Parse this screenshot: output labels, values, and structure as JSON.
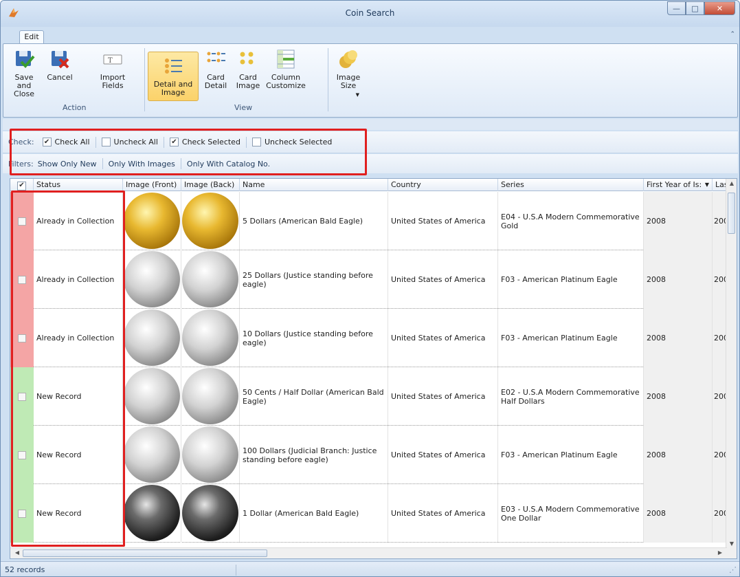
{
  "window": {
    "title": "Coin Search"
  },
  "ribbon": {
    "tab": "Edit",
    "buttons": {
      "save_close": "Save and\nClose",
      "cancel": "Cancel",
      "import_fields": "Import\nFields",
      "detail_image": "Detail and\nImage",
      "card_detail": "Card\nDetail",
      "card_image": "Card\nImage",
      "column_customize": "Column\nCustomize",
      "image_size": "Image\nSize"
    },
    "groups": {
      "action": "Action",
      "view": "View"
    }
  },
  "checkbar": {
    "label": "Check:",
    "check_all": "Check All",
    "uncheck_all": "Uncheck All",
    "check_selected": "Check Selected",
    "uncheck_selected": "Uncheck Selected"
  },
  "filterbar": {
    "label": "Filters:",
    "show_only_new": "Show Only New",
    "only_with_images": "Only With Images",
    "only_with_catalog": "Only With Catalog No."
  },
  "grid": {
    "columns": [
      "Status",
      "Image (Front)",
      "Image (Back)",
      "Name",
      "Country",
      "Series",
      "First Year of Is:",
      "Last"
    ],
    "rows": [
      {
        "status": "Already in Collection",
        "status_color": "#f4a5a5",
        "name": "5 Dollars (American Bald Eagle)",
        "country": "United States of America",
        "series": "E04 - U.S.A Modern Commemorative Gold",
        "first_year": "2008",
        "last_year": "200",
        "metal": "gold"
      },
      {
        "status": "Already in Collection",
        "status_color": "#f4a5a5",
        "name": "25 Dollars (Justice standing before eagle)",
        "country": "United States of America",
        "series": "F03 - American Platinum Eagle",
        "first_year": "2008",
        "last_year": "200",
        "metal": "silver"
      },
      {
        "status": "Already in Collection",
        "status_color": "#f4a5a5",
        "name": "10 Dollars (Justice standing before eagle)",
        "country": "United States of America",
        "series": "F03 - American Platinum Eagle",
        "first_year": "2008",
        "last_year": "200",
        "metal": "silver"
      },
      {
        "status": "New Record",
        "status_color": "#bfeab5",
        "name": "50 Cents / Half Dollar (American Bald Eagle)",
        "country": "United States of America",
        "series": "E02 - U.S.A Modern Commemorative Half Dollars",
        "first_year": "2008",
        "last_year": "200",
        "metal": "silver"
      },
      {
        "status": "New Record",
        "status_color": "#bfeab5",
        "name": "100 Dollars (Judicial Branch: Justice standing before eagle)",
        "country": "United States of America",
        "series": "F03 - American Platinum Eagle",
        "first_year": "2008",
        "last_year": "200",
        "metal": "silver"
      },
      {
        "status": "New Record",
        "status_color": "#bfeab5",
        "name": "1 Dollar (American Bald Eagle)",
        "country": "United States of America",
        "series": "E03 - U.S.A Modern Commemorative One Dollar",
        "first_year": "2008",
        "last_year": "200",
        "metal": "dark"
      }
    ]
  },
  "statusbar": {
    "records": "52 records"
  }
}
